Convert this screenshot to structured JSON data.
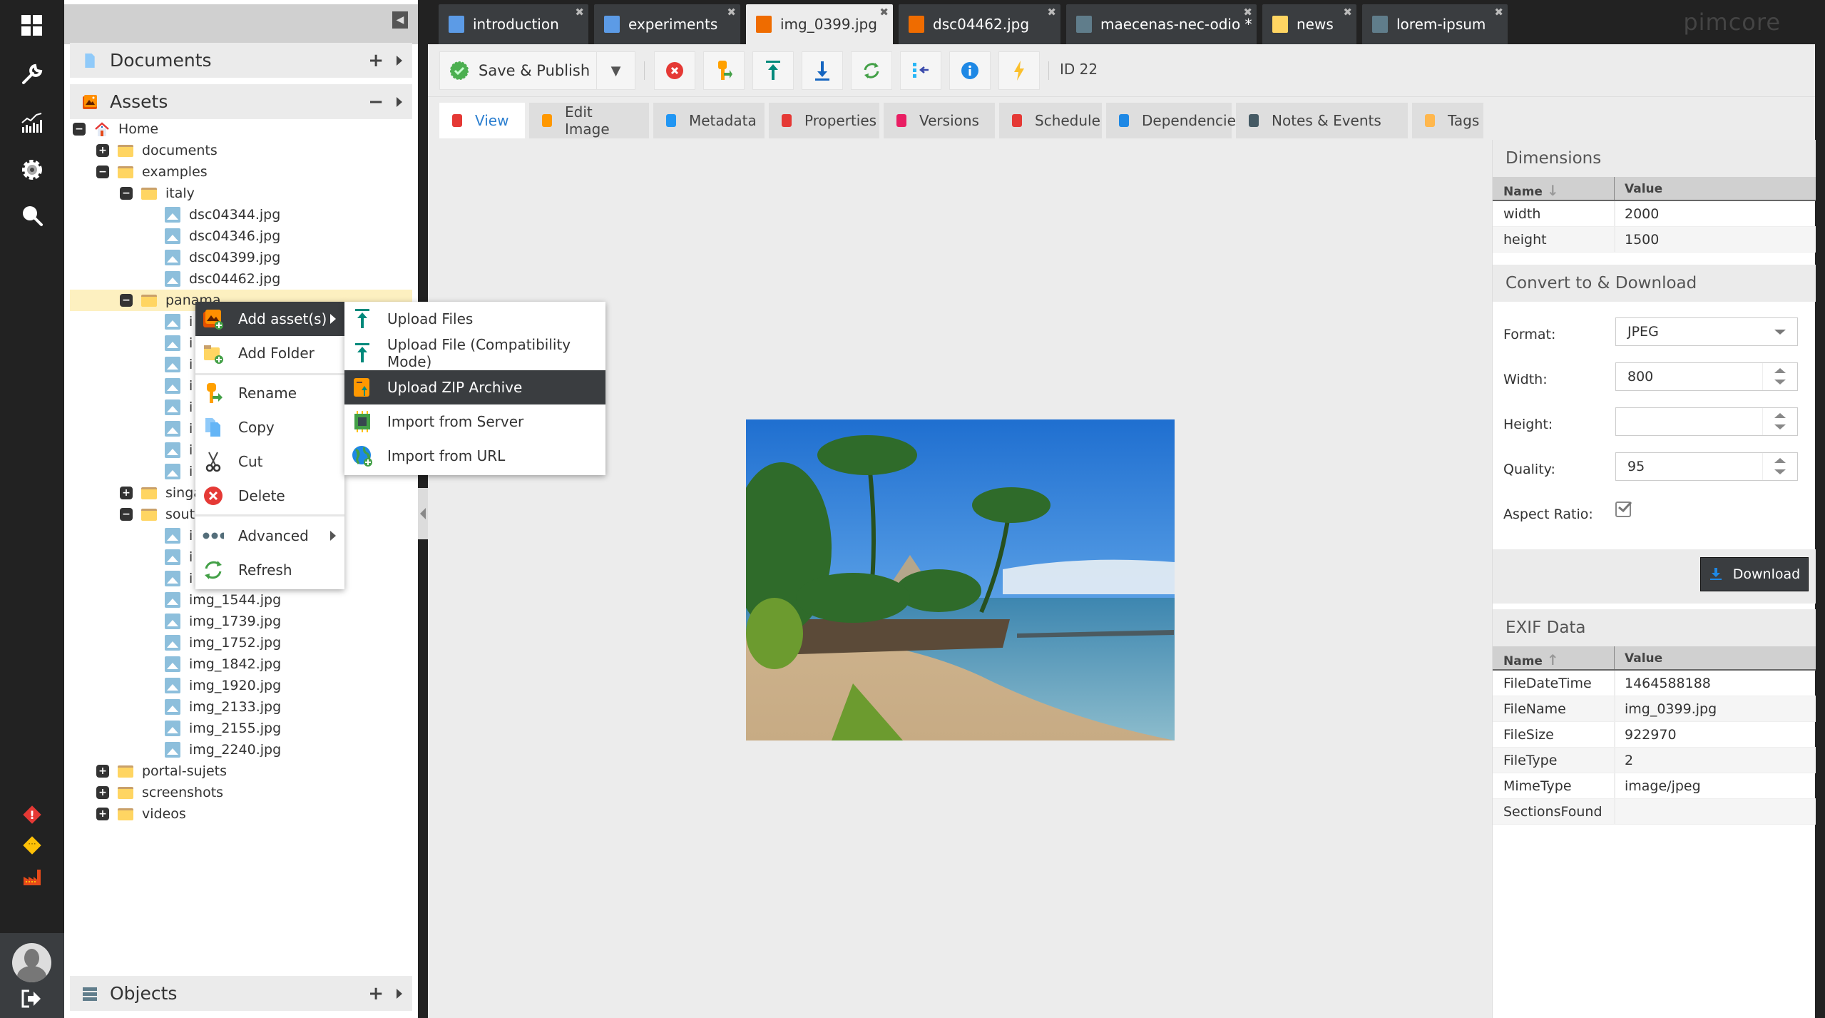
{
  "nav": {
    "items": [
      {
        "name": "dashboard-icon",
        "glyph": "▦"
      },
      {
        "name": "tools-wrench-icon",
        "glyph": "🔧"
      },
      {
        "name": "marketing-chart-icon",
        "glyph": "📈"
      },
      {
        "name": "settings-gear-icon",
        "glyph": "⚙"
      },
      {
        "name": "search-icon",
        "glyph": "🔍"
      }
    ],
    "notifications": [
      {
        "name": "error-notification-icon",
        "glyph": "!",
        "color": "#e53935"
      },
      {
        "name": "maintenance-notification-icon",
        "glyph": "…",
        "color": "#ffc107"
      },
      {
        "name": "factory-icon",
        "glyph": "▙",
        "color": "#e64a19"
      }
    ]
  },
  "tree_panel": {
    "documents": {
      "title": "Documents",
      "plus": "+"
    },
    "assets": {
      "title": "Assets",
      "minus": "−"
    },
    "objects": {
      "title": "Objects",
      "plus": "+"
    },
    "rows": [
      {
        "label": "Home",
        "level": 0,
        "toggle": "−",
        "icon": "home"
      },
      {
        "label": "documents",
        "level": 1,
        "toggle": "+",
        "icon": "folder"
      },
      {
        "label": "examples",
        "level": 1,
        "toggle": "−",
        "icon": "folder"
      },
      {
        "label": "italy",
        "level": 2,
        "toggle": "−",
        "icon": "folder"
      },
      {
        "label": "dsc04344.jpg",
        "level": 3,
        "toggle": "",
        "icon": "image"
      },
      {
        "label": "dsc04346.jpg",
        "level": 3,
        "toggle": "",
        "icon": "image"
      },
      {
        "label": "dsc04399.jpg",
        "level": 3,
        "toggle": "",
        "icon": "image"
      },
      {
        "label": "dsc04462.jpg",
        "level": 3,
        "toggle": "",
        "icon": "image"
      },
      {
        "label": "panama",
        "level": 2,
        "toggle": "−",
        "icon": "folder",
        "selected": true
      },
      {
        "label": "i",
        "level": 3,
        "toggle": "",
        "icon": "image"
      },
      {
        "label": "i",
        "level": 3,
        "toggle": "",
        "icon": "image"
      },
      {
        "label": "i",
        "level": 3,
        "toggle": "",
        "icon": "image"
      },
      {
        "label": "i",
        "level": 3,
        "toggle": "",
        "icon": "image"
      },
      {
        "label": "i",
        "level": 3,
        "toggle": "",
        "icon": "image"
      },
      {
        "label": "i",
        "level": 3,
        "toggle": "",
        "icon": "image"
      },
      {
        "label": "i",
        "level": 3,
        "toggle": "",
        "icon": "image"
      },
      {
        "label": "i",
        "level": 3,
        "toggle": "",
        "icon": "image"
      },
      {
        "label": "singa",
        "level": 2,
        "toggle": "+",
        "icon": "folder"
      },
      {
        "label": "sout",
        "level": 2,
        "toggle": "−",
        "icon": "folder"
      },
      {
        "label": "i",
        "level": 3,
        "toggle": "",
        "icon": "image"
      },
      {
        "label": "i",
        "level": 3,
        "toggle": "",
        "icon": "image"
      },
      {
        "label": "i",
        "level": 3,
        "toggle": "",
        "icon": "image"
      },
      {
        "label": "img_1544.jpg",
        "level": 3,
        "toggle": "",
        "icon": "image"
      },
      {
        "label": "img_1739.jpg",
        "level": 3,
        "toggle": "",
        "icon": "image"
      },
      {
        "label": "img_1752.jpg",
        "level": 3,
        "toggle": "",
        "icon": "image"
      },
      {
        "label": "img_1842.jpg",
        "level": 3,
        "toggle": "",
        "icon": "image"
      },
      {
        "label": "img_1920.jpg",
        "level": 3,
        "toggle": "",
        "icon": "image"
      },
      {
        "label": "img_2133.jpg",
        "level": 3,
        "toggle": "",
        "icon": "image"
      },
      {
        "label": "img_2155.jpg",
        "level": 3,
        "toggle": "",
        "icon": "image"
      },
      {
        "label": "img_2240.jpg",
        "level": 3,
        "toggle": "",
        "icon": "image"
      },
      {
        "label": "portal-sujets",
        "level": 1,
        "toggle": "+",
        "icon": "folder"
      },
      {
        "label": "screenshots",
        "level": 1,
        "toggle": "+",
        "icon": "folder"
      },
      {
        "label": "videos",
        "level": 1,
        "toggle": "+",
        "icon": "folder"
      }
    ]
  },
  "context_menu": {
    "items": [
      {
        "label": "Add asset(s)",
        "icon": "add-asset-icon",
        "submenu": true,
        "active": true
      },
      {
        "label": "Add Folder",
        "icon": "add-folder-icon"
      },
      {
        "label": "Rename",
        "icon": "rename-key-icon"
      },
      {
        "label": "Copy",
        "icon": "copy-icon"
      },
      {
        "label": "Cut",
        "icon": "cut-scissors-icon"
      },
      {
        "label": "Delete",
        "icon": "delete-icon"
      },
      {
        "label": "Advanced",
        "icon": "advanced-dots-icon",
        "submenu": true
      },
      {
        "label": "Refresh",
        "icon": "refresh-icon"
      }
    ],
    "submenu": [
      {
        "label": "Upload Files",
        "icon": "upload-icon"
      },
      {
        "label": "Upload File (Compatibility Mode)",
        "icon": "upload-compat-icon"
      },
      {
        "label": "Upload ZIP Archive",
        "icon": "zip-archive-icon",
        "active": true
      },
      {
        "label": "Import from Server",
        "icon": "server-chip-icon"
      },
      {
        "label": "Import from URL",
        "icon": "globe-url-icon"
      }
    ]
  },
  "tabs": [
    {
      "label": "introduction",
      "icon": "document",
      "close": "✖"
    },
    {
      "label": "experiments",
      "icon": "document",
      "close": "✖"
    },
    {
      "label": "img_0399.jpg",
      "icon": "image",
      "close": "✖",
      "active": true
    },
    {
      "label": "dsc04462.jpg",
      "icon": "image",
      "close": "✖"
    },
    {
      "label": "maecenas-nec-odio *",
      "icon": "object",
      "close": "✖"
    },
    {
      "label": "news",
      "icon": "folder",
      "close": "✖"
    },
    {
      "label": "lorem-ipsum",
      "icon": "object",
      "close": "✖"
    }
  ],
  "brand": {
    "logo": "pimcore"
  },
  "toolbar": {
    "save_publish": "Save & Publish",
    "dropdown": "▼",
    "id_label": "ID 22"
  },
  "subtabs": [
    {
      "label": "View",
      "active": true
    },
    {
      "label": "Edit Image"
    },
    {
      "label": "Metadata"
    },
    {
      "label": "Properties"
    },
    {
      "label": "Versions"
    },
    {
      "label": "Schedule"
    },
    {
      "label": "Dependencies"
    },
    {
      "label": "Notes & Events"
    },
    {
      "label": "Tags"
    }
  ],
  "dimensions": {
    "title": "Dimensions",
    "col_name": "Name",
    "col_value": "Value",
    "sort": "↓",
    "rows": [
      {
        "name": "width",
        "value": "2000"
      },
      {
        "name": "height",
        "value": "1500"
      }
    ]
  },
  "convert": {
    "title": "Convert to & Download",
    "format_label": "Format:",
    "format_value": "JPEG",
    "width_label": "Width:",
    "width_value": "800",
    "height_label": "Height:",
    "height_value": "",
    "quality_label": "Quality:",
    "quality_value": "95",
    "aspect_label": "Aspect Ratio:",
    "aspect_checked": true,
    "download": "Download"
  },
  "exif": {
    "title": "EXIF Data",
    "col_name": "Name",
    "col_value": "Value",
    "sort": "↑",
    "rows": [
      {
        "name": "FileDateTime",
        "value": "1464588188"
      },
      {
        "name": "FileName",
        "value": "img_0399.jpg"
      },
      {
        "name": "FileSize",
        "value": "922970"
      },
      {
        "name": "FileType",
        "value": "2"
      },
      {
        "name": "MimeType",
        "value": "image/jpeg"
      },
      {
        "name": "SectionsFound",
        "value": ""
      }
    ]
  }
}
